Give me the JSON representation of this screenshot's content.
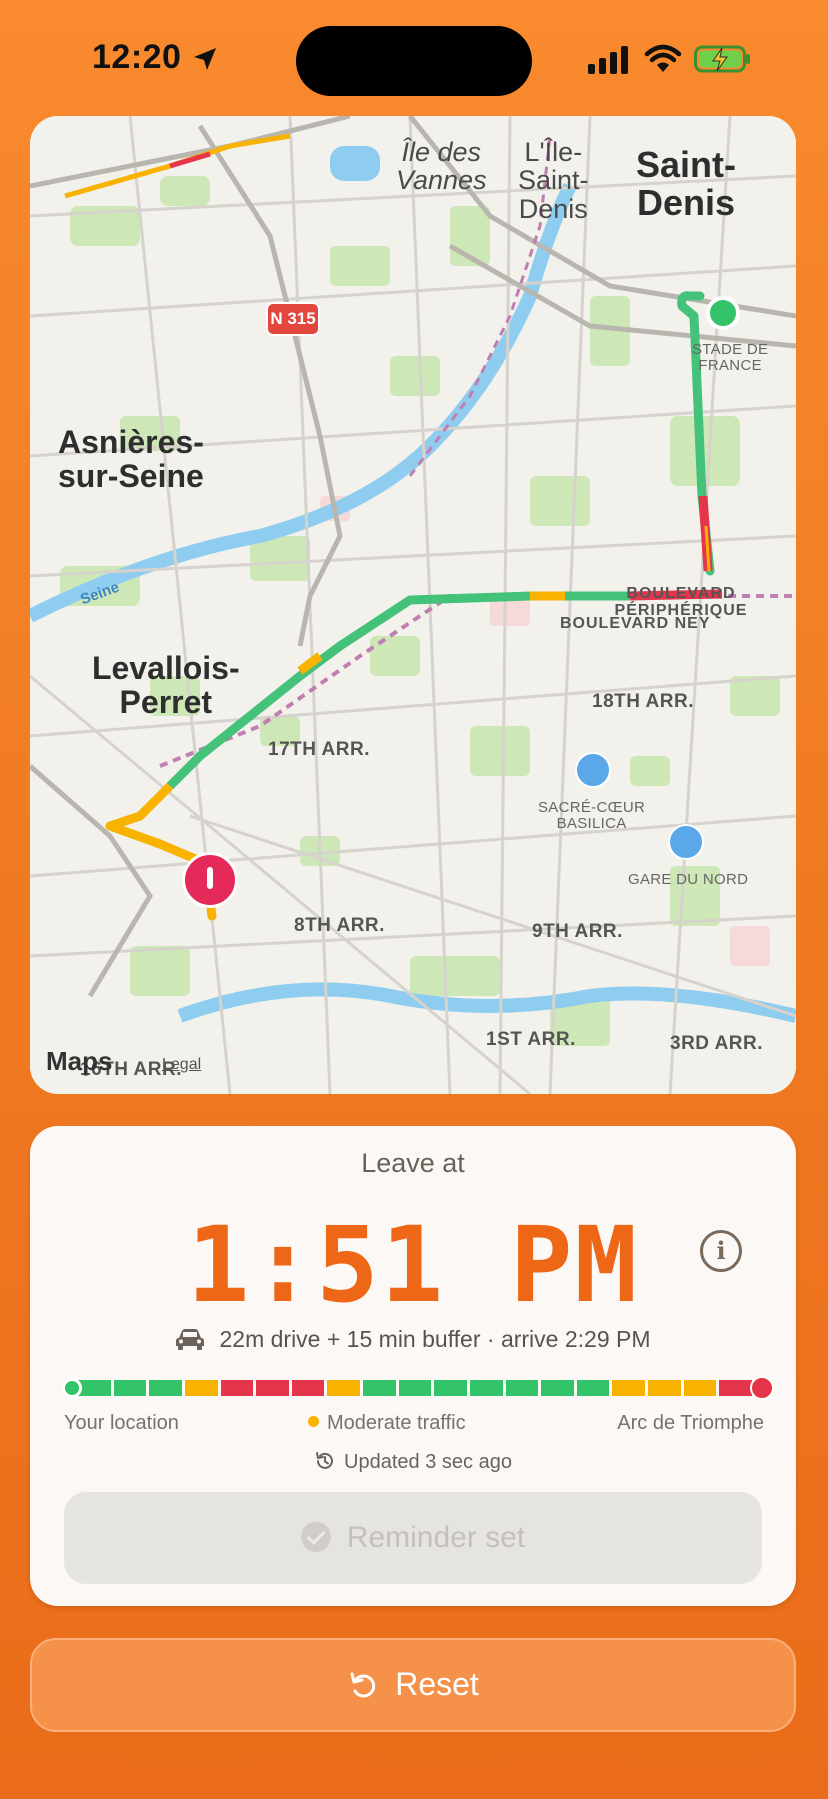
{
  "status_bar": {
    "time": "12:20"
  },
  "map": {
    "labels": {
      "ile_des_vannes": "Île des\nVannes",
      "ile_saint_denis": "L'Île-\nSaint-\nDenis",
      "saint_denis": "Saint-\nDenis",
      "stade": "STADE DE\nFRANCE",
      "asnieres": "Asnières-\nsur-Seine",
      "seine": "Seine",
      "levallois": "Levallois-\nPerret",
      "bd_peripherique": "BOULEVARD PÉRIPHÉRIQUE",
      "bd_ney": "BOULEVARD NEY",
      "arr_18": "18TH ARR.",
      "arr_17": "17TH ARR.",
      "sacre_coeur": "SACRÉ-CŒUR\nBASILICA",
      "gare_du_nord": "GARE DU NORD",
      "arr_8": "8TH ARR.",
      "arr_9": "9TH ARR.",
      "arr_1": "1ST ARR.",
      "arr_3": "3RD ARR.",
      "arr_16": "16TH ARR."
    },
    "road_shield": "N 315",
    "attribution": "Maps",
    "legal": "Legal"
  },
  "card": {
    "leave_label": "Leave at",
    "leave_time": "1:51 PM",
    "drive_summary": "22m drive + 15 min buffer · arrive 2:29 PM",
    "origin": "Your location",
    "traffic_status": "Moderate traffic",
    "destination": "Arc de Triomphe",
    "updated": "Updated 3 sec ago",
    "reminder_label": "Reminder set",
    "traffic_segments": [
      "green",
      "green",
      "green",
      "yellow",
      "red",
      "red",
      "red",
      "yellow",
      "green",
      "green",
      "green",
      "green",
      "green",
      "green",
      "green",
      "yellow",
      "yellow",
      "yellow",
      "red"
    ]
  },
  "reset_label": "Reset",
  "colors": {
    "accent": "#ee6716",
    "green": "#33c46a",
    "yellow": "#f8b200",
    "red": "#e5354a",
    "background": "#f07a22"
  }
}
